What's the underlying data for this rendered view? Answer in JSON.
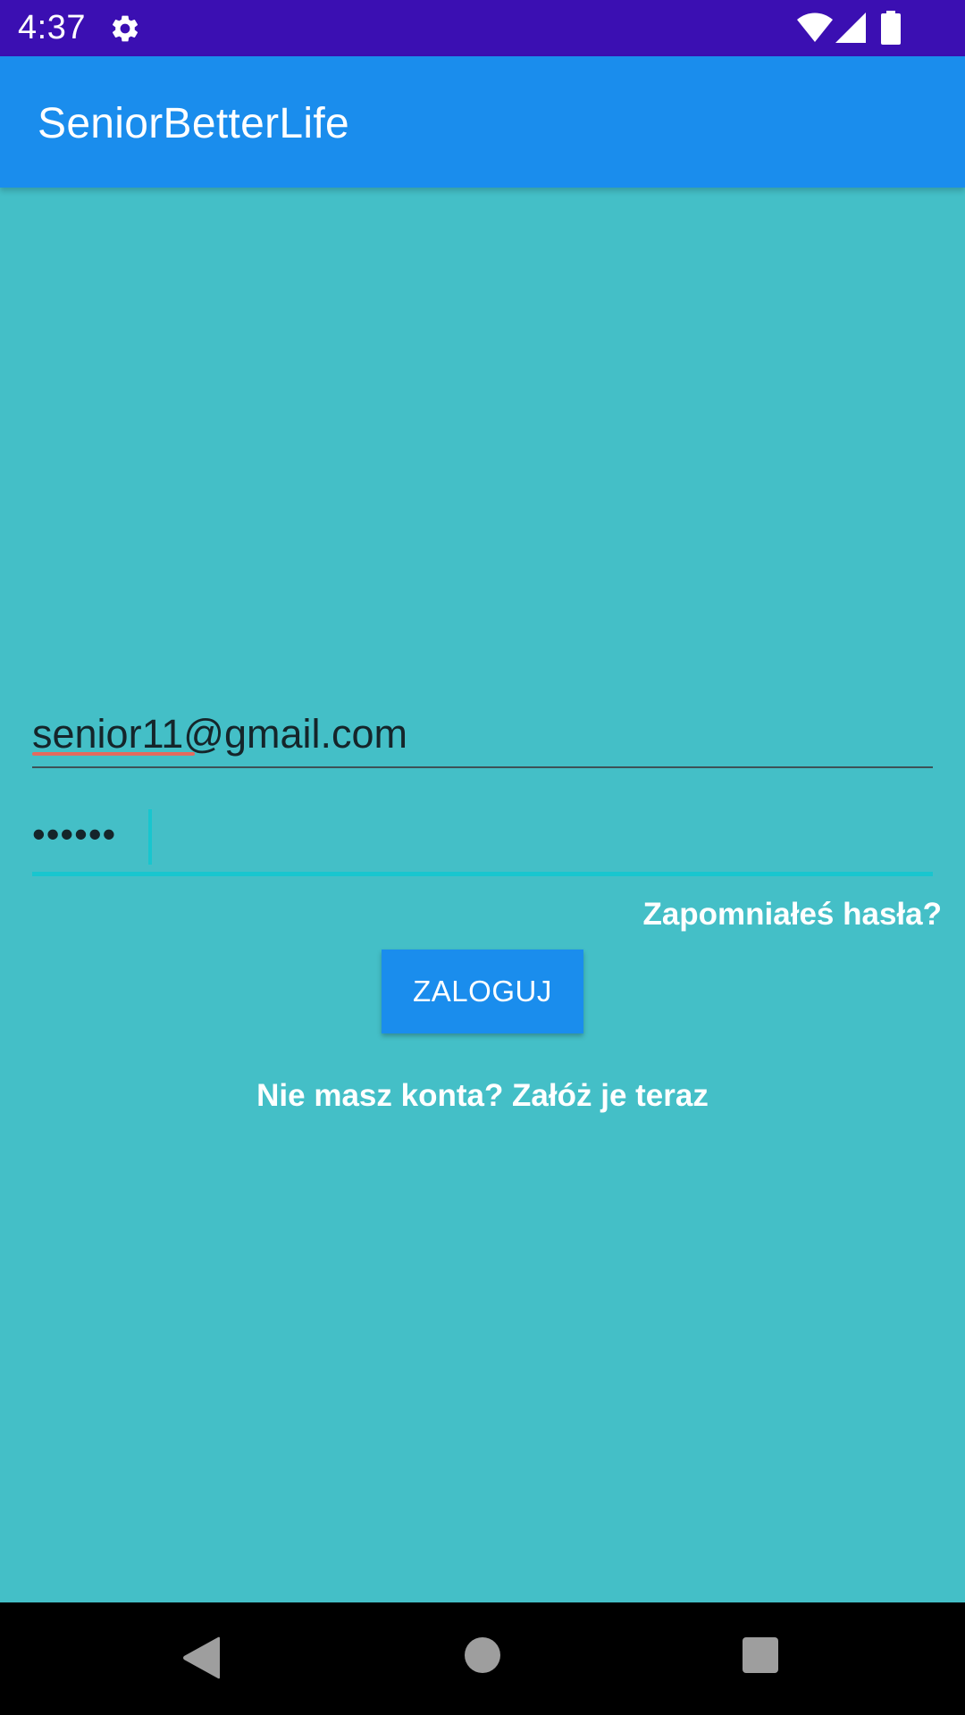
{
  "status_bar": {
    "time": "4:37",
    "icons": [
      "gear-icon",
      "wifi-icon",
      "signal-icon",
      "battery-icon"
    ],
    "background": "#3b0fb2"
  },
  "app_bar": {
    "title": "SeniorBetterLife",
    "background": "#1a8ded"
  },
  "login_form": {
    "email_value": "senior11@gmail.com",
    "password_value": "••••••",
    "forgot_password_label": "Zapomniałeś hasła?",
    "login_button_label": "ZALOGUJ",
    "signup_label": "Nie masz konta? Załóż je teraz"
  },
  "nav_bar": {
    "icons": [
      "back-icon",
      "home-icon",
      "recent-apps-icon"
    ]
  },
  "colors": {
    "background": "#44bfc7",
    "accent": "#18c6cf",
    "primary": "#1a8ded"
  }
}
